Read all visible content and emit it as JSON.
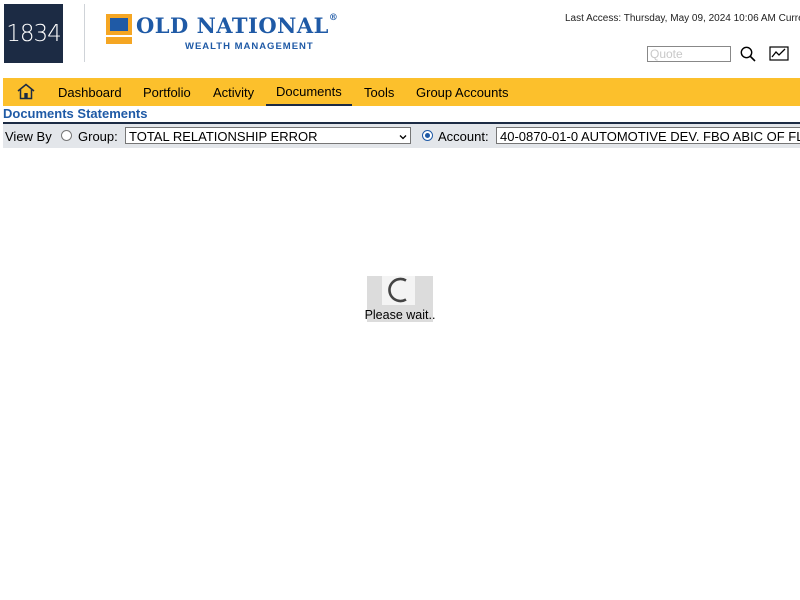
{
  "brand": {
    "badge": "1834",
    "name": "OLD NATIONAL",
    "trademark": "®",
    "subtitle": "WEALTH MANAGEMENT",
    "primary_color": "#1f5aa6",
    "accent_color": "#f5a623",
    "badge_color": "#1c2b44"
  },
  "header": {
    "last_access": "Last Access: Thursday, May 09, 2024 10:06 AM Curre",
    "quote_placeholder": "Quote",
    "search_icon": "search-icon",
    "chart_icon": "line-chart-icon"
  },
  "nav": {
    "bar_color": "#fcc02c",
    "home_icon": "home-icon",
    "items": [
      {
        "label": "Dashboard",
        "active": false
      },
      {
        "label": "Portfolio",
        "active": false
      },
      {
        "label": "Activity",
        "active": false
      },
      {
        "label": "Documents",
        "active": true
      },
      {
        "label": "Tools",
        "active": false
      },
      {
        "label": "Group Accounts",
        "active": false
      }
    ]
  },
  "page": {
    "title": "Documents Statements"
  },
  "filter": {
    "view_by": "View By",
    "group_label": "Group:",
    "group_selected": false,
    "group_value": "TOTAL RELATIONSHIP ERROR",
    "account_label": "Account:",
    "account_selected": true,
    "account_value": "40-0870-01-0 AUTOMOTIVE DEV. FBO ABIC OF FL"
  },
  "loading": {
    "message": "Please wait.."
  }
}
